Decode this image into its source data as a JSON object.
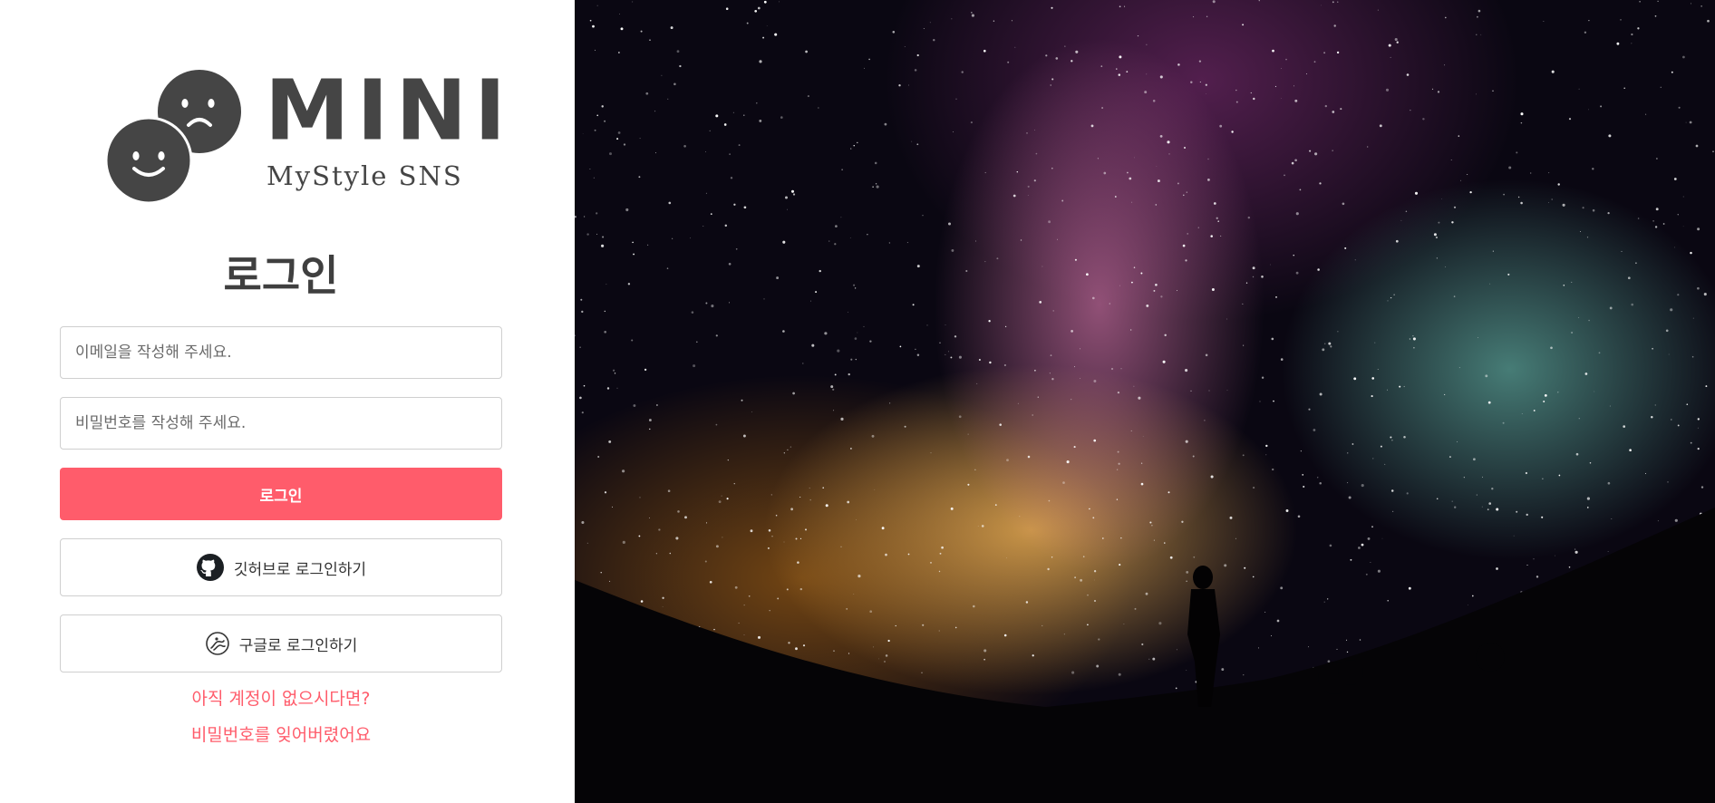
{
  "brand": {
    "name": "MINI",
    "tagline": "MyStyle SNS"
  },
  "login": {
    "title": "로그인",
    "email_placeholder": "이메일을 작성해 주세요.",
    "password_placeholder": "비밀번호를 작성해 주세요.",
    "submit_label": "로그인",
    "github_label": "깃허브로 로그인하기",
    "google_label": "구글로 로그인하기",
    "signup_link": "아직 계정이 없으시다면?",
    "forgot_link": "비밀번호를 잊어버렸어요"
  },
  "icons": {
    "logo": "two-faces-logo",
    "github": "github-icon",
    "google": "google-icon"
  },
  "colors": {
    "accent": "#ff5c6b",
    "logo_gray": "#454545",
    "border": "#cfcfcf"
  }
}
